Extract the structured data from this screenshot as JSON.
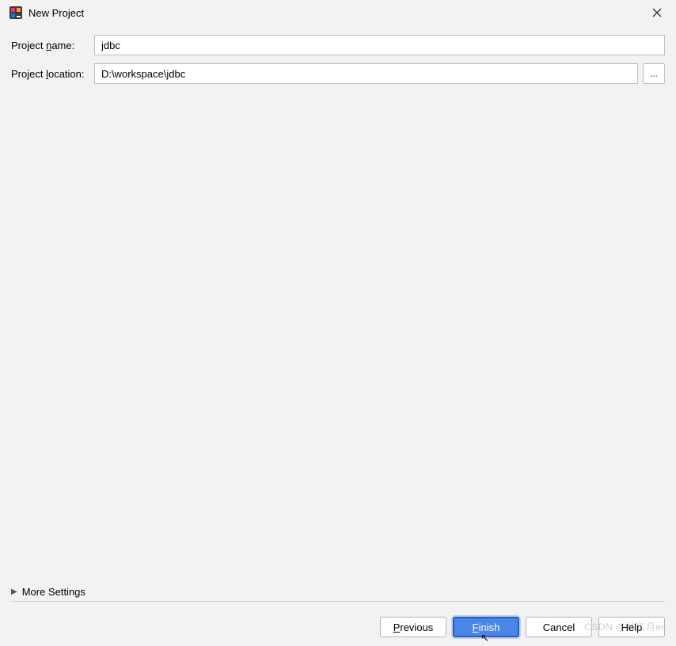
{
  "window": {
    "title": "New Project"
  },
  "form": {
    "project_name_label_pre": "Project ",
    "project_name_label_m": "n",
    "project_name_label_post": "ame:",
    "project_name_value": "jdbc",
    "project_location_label_pre": "Project ",
    "project_location_label_m": "l",
    "project_location_label_post": "ocation:",
    "project_location_value": "D:\\workspace\\jdbc",
    "browse_label": "..."
  },
  "more_settings": {
    "label": "More Settings"
  },
  "footer": {
    "previous_m": "P",
    "previous_rest": "revious",
    "finish_m": "F",
    "finish_rest": "inish",
    "cancel_label": "Cancel",
    "help_label": "Help"
  },
  "watermark": "CSDN @林二月er"
}
